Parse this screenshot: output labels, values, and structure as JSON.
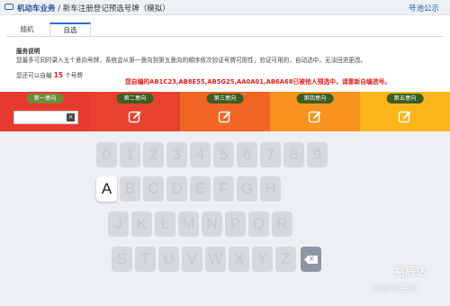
{
  "topbar": {
    "section": "机动车业务",
    "separator": " / ",
    "page": "新车注册登记预选号牌（模拟）",
    "notice_link": "号池公示"
  },
  "tabs": [
    {
      "label": "随机"
    },
    {
      "label": "自选"
    }
  ],
  "info": {
    "title": "服务说明",
    "description": "您最多可同时录入五个意向号牌，系统会从第一意向到第五意向的顺序依次验证号牌可用性，验证可用的，自动选中，无法回退更改。",
    "remaining_prefix": "您还可以自编",
    "remaining_count": "15",
    "remaining_suffix": "个号牌",
    "warning": "您自编的AB1C23,AB8E55,AB5G25,AA0A01,AB6A68已被他人预选中，请重新自编选号。"
  },
  "choices": [
    {
      "label": "第一意向",
      "input_value": ""
    },
    {
      "label": "第二意向"
    },
    {
      "label": "第三意向"
    },
    {
      "label": "第四意向"
    },
    {
      "label": "第五意向"
    }
  ],
  "keyboard": {
    "row1": [
      "0",
      "1",
      "2",
      "3",
      "4",
      "5",
      "6",
      "7",
      "8",
      "9"
    ],
    "row2": [
      "A",
      "B",
      "C",
      "D",
      "E",
      "F",
      "G",
      "H"
    ],
    "row3": [
      "J",
      "K",
      "L",
      "M",
      "N",
      "P",
      "Q",
      "R"
    ],
    "row4": [
      "S",
      "T",
      "U",
      "V",
      "W",
      "X",
      "Y",
      "Z"
    ],
    "delete_icon": "backspace-icon",
    "active_key": "A"
  },
  "watermark": {
    "line1": "裕辰达",
    "line2": "◎阿可来啦"
  },
  "colors": {
    "seg1": "#e63b2e",
    "seg2": "#e8412f",
    "seg3": "#f26524",
    "seg4": "#f7931e",
    "seg5": "#fbb51b",
    "warning": "#e02020",
    "tab_accent": "#2f6cc4"
  }
}
